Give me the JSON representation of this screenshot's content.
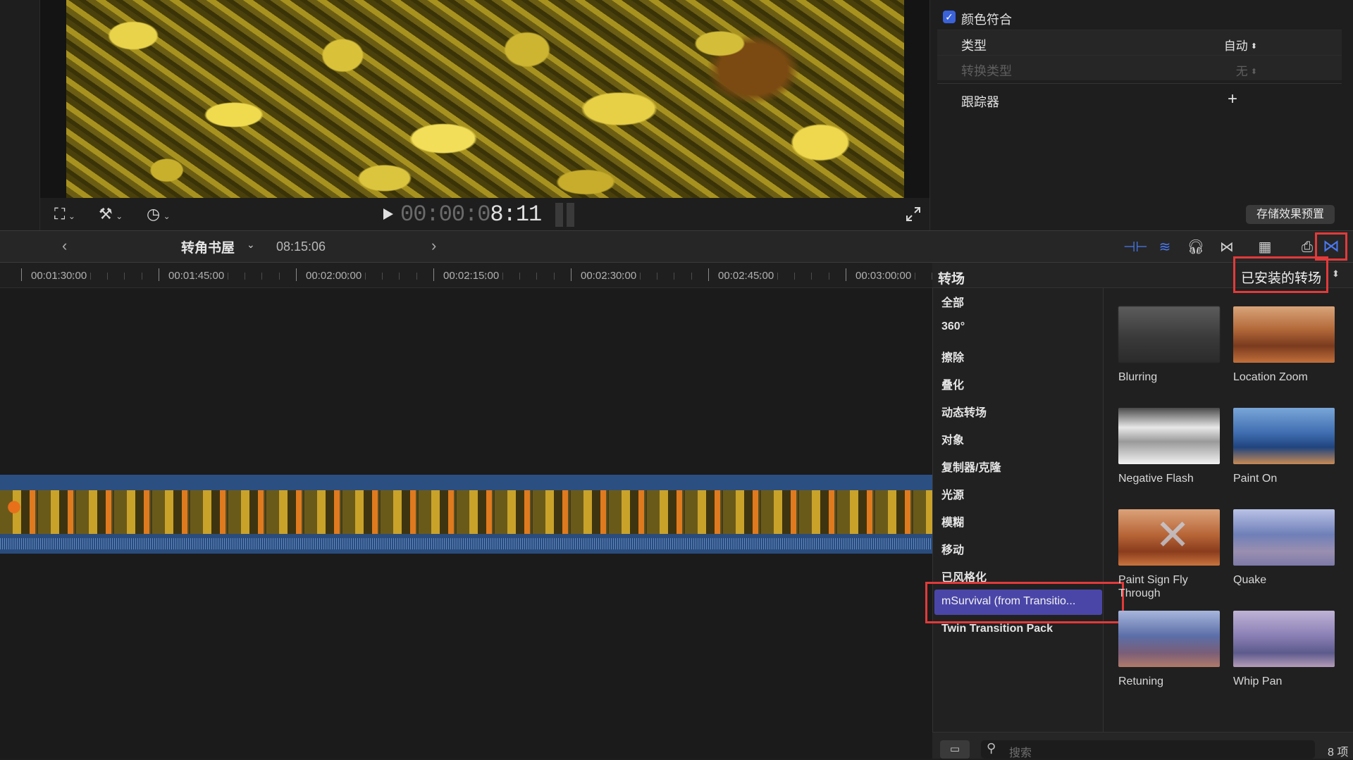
{
  "viewer": {
    "timecode_dim": "00:00:0",
    "timecode_bright": "8:11",
    "tools": [
      "transform-icon",
      "magic-wand-icon",
      "speed-icon"
    ]
  },
  "inspector": {
    "color_conform": {
      "label": "颜色符合",
      "checked": true
    },
    "type": {
      "label": "类型",
      "value": "自动"
    },
    "conversion_type": {
      "label": "转换类型",
      "value": "无"
    },
    "tracker": {
      "label": "跟踪器",
      "add": "+"
    },
    "save_preset": "存储效果预置"
  },
  "timeline": {
    "project_name": "转角书屋",
    "duration": "08:15:06",
    "ruler": [
      "00:01:30:00",
      "00:01:45:00",
      "00:02:00:00",
      "00:02:15:00",
      "00:02:30:00",
      "00:02:45:00",
      "00:03:00:00"
    ]
  },
  "browser": {
    "title": "转场",
    "filter": "已安装的转场",
    "categories": [
      "全部",
      "360°",
      "擦除",
      "叠化",
      "动态转场",
      "对象",
      "复制器/克隆",
      "光源",
      "模糊",
      "移动",
      "已风格化",
      "mSurvival (from Transitio...",
      "Twin Transition Pack"
    ],
    "selected_category": "mSurvival (from Transitio...",
    "items": [
      {
        "label": "Blurring"
      },
      {
        "label": "Location Zoom"
      },
      {
        "label": "Negative Flash"
      },
      {
        "label": "Paint On"
      },
      {
        "label": "Paint Sign Fly Through"
      },
      {
        "label": "Quake"
      },
      {
        "label": "Retuning"
      },
      {
        "label": "Whip Pan"
      }
    ],
    "search_placeholder": "搜索",
    "item_count": "8 项"
  },
  "colors": {
    "selection": "#4a46a8",
    "highlight_box": "#e23a3a",
    "accent": "#4a78f0"
  }
}
